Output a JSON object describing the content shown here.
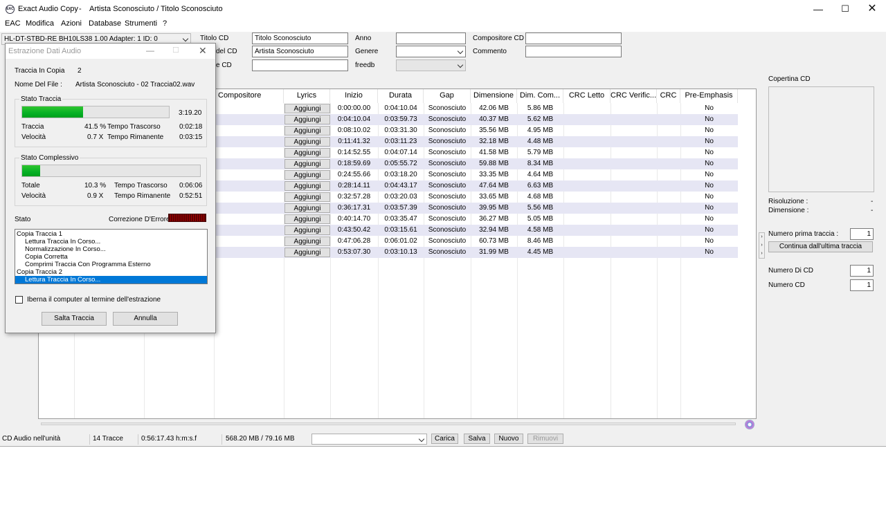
{
  "window": {
    "app_name": "Exact Audio Copy",
    "title": "Artista Sconosciuto / Titolo Sconosciuto",
    "icon_text": "EAC"
  },
  "menu": [
    "EAC",
    "Modifica",
    "Azioni",
    "Database",
    "Strumenti",
    "?"
  ],
  "drive": {
    "selected": "HL-DT-STBD-RE  BH10LS38 1.00   Adapter: 1  ID: 0"
  },
  "cdinfo": {
    "titolo_label": "Titolo CD",
    "titolo_value": "Titolo Sconosciuto",
    "artista_label": "del CD",
    "artista_value": "Artista Sconosciuto",
    "third_label": "e CD",
    "third_value": "",
    "anno_label": "Anno",
    "anno_value": "",
    "genere_label": "Genere",
    "genere_value": "",
    "freedb_label": "freedb",
    "freedb_value": "",
    "compositore_label": "Compositore CD",
    "compositore_value": "",
    "commento_label": "Commento",
    "commento_value": ""
  },
  "table": {
    "headers": [
      "Compositore",
      "Lyrics",
      "Inizio",
      "Durata",
      "Gap",
      "Dimensione",
      "Dim. Com...",
      "CRC Letto",
      "CRC Verific...",
      "CRC",
      "Pre-Emphasis"
    ],
    "lyrics_button": "Aggiungi",
    "rows": [
      {
        "inizio": "0:00:00.00",
        "durata": "0:04:10.04",
        "gap": "Sconosciuto",
        "dim": "42.06 MB",
        "dimc": "5.86 MB",
        "pre": "No"
      },
      {
        "inizio": "0:04:10.04",
        "durata": "0:03:59.73",
        "gap": "Sconosciuto",
        "dim": "40.37 MB",
        "dimc": "5.62 MB",
        "pre": "No"
      },
      {
        "inizio": "0:08:10.02",
        "durata": "0:03:31.30",
        "gap": "Sconosciuto",
        "dim": "35.56 MB",
        "dimc": "4.95 MB",
        "pre": "No"
      },
      {
        "inizio": "0:11:41.32",
        "durata": "0:03:11.23",
        "gap": "Sconosciuto",
        "dim": "32.18 MB",
        "dimc": "4.48 MB",
        "pre": "No"
      },
      {
        "inizio": "0:14:52.55",
        "durata": "0:04:07.14",
        "gap": "Sconosciuto",
        "dim": "41.58 MB",
        "dimc": "5.79 MB",
        "pre": "No"
      },
      {
        "inizio": "0:18:59.69",
        "durata": "0:05:55.72",
        "gap": "Sconosciuto",
        "dim": "59.88 MB",
        "dimc": "8.34 MB",
        "pre": "No"
      },
      {
        "inizio": "0:24:55.66",
        "durata": "0:03:18.20",
        "gap": "Sconosciuto",
        "dim": "33.35 MB",
        "dimc": "4.64 MB",
        "pre": "No"
      },
      {
        "inizio": "0:28:14.11",
        "durata": "0:04:43.17",
        "gap": "Sconosciuto",
        "dim": "47.64 MB",
        "dimc": "6.63 MB",
        "pre": "No"
      },
      {
        "inizio": "0:32:57.28",
        "durata": "0:03:20.03",
        "gap": "Sconosciuto",
        "dim": "33.65 MB",
        "dimc": "4.68 MB",
        "pre": "No"
      },
      {
        "inizio": "0:36:17.31",
        "durata": "0:03:57.39",
        "gap": "Sconosciuto",
        "dim": "39.95 MB",
        "dimc": "5.56 MB",
        "pre": "No"
      },
      {
        "inizio": "0:40:14.70",
        "durata": "0:03:35.47",
        "gap": "Sconosciuto",
        "dim": "36.27 MB",
        "dimc": "5.05 MB",
        "pre": "No"
      },
      {
        "inizio": "0:43:50.42",
        "durata": "0:03:15.61",
        "gap": "Sconosciuto",
        "dim": "32.94 MB",
        "dimc": "4.58 MB",
        "pre": "No"
      },
      {
        "inizio": "0:47:06.28",
        "durata": "0:06:01.02",
        "gap": "Sconosciuto",
        "dim": "60.73 MB",
        "dimc": "8.46 MB",
        "pre": "No"
      },
      {
        "inizio": "0:53:07.30",
        "durata": "0:03:10.13",
        "gap": "Sconosciuto",
        "dim": "31.99 MB",
        "dimc": "4.45 MB",
        "pre": "No"
      }
    ]
  },
  "right_panel": {
    "copertina": "Copertina CD",
    "risoluzione_label": "Risoluzione :",
    "risoluzione_value": "-",
    "dimensione_label": "Dimensione :",
    "dimensione_value": "-",
    "prima_traccia_label": "Numero prima traccia :",
    "prima_traccia_value": "1",
    "continua_button": "Continua dall'ultima traccia",
    "numero_di_cd_label": "Numero Di CD",
    "numero_di_cd_value": "1",
    "numero_cd_label": "Numero CD",
    "numero_cd_value": "1"
  },
  "status_bar": {
    "cd": "CD Audio nell'unità",
    "tracce": "14 Tracce",
    "durata": "0:56:17.43 h:m:s.f",
    "dimensioni": "568.20 MB /  79.16 MB",
    "carica": "Carica",
    "salva": "Salva",
    "nuovo": "Nuovo",
    "rimuovi": "Rimuovi"
  },
  "dialog": {
    "title": "Estrazione Dati Audio",
    "traccia_in_copia_label": "Traccia In Copia",
    "traccia_in_copia_value": "2",
    "nome_file_label": "Nome Del File :",
    "nome_file_value": "Artista Sconosciuto - 02 Traccia02.wav",
    "stato_traccia": {
      "title": "Stato Traccia",
      "time": "3:19.20",
      "progress": 0.415,
      "traccia_label": "Traccia",
      "traccia_value": "41.5 %",
      "velocita_label": "Velocità",
      "velocita_value": "0.7 X",
      "trascorso_label": "Tempo Trascorso",
      "trascorso_value": "0:02:18",
      "rimanente_label": "Tempo Rimanente",
      "rimanente_value": "0:03:15"
    },
    "stato_complessivo": {
      "title": "Stato Complessivo",
      "progress": 0.103,
      "totale_label": "Totale",
      "totale_value": "10.3 %",
      "velocita_label": "Velocità",
      "velocita_value": "0.9 X",
      "trascorso_label": "Tempo Trascorso",
      "trascorso_value": "0:06:06",
      "rimanente_label": "Tempo Rimanente",
      "rimanente_value": "0:52:51"
    },
    "stato_label": "Stato",
    "correzione_label": "Correzione D'Errore :",
    "log": [
      {
        "text": "Copia Traccia  1",
        "indent": false,
        "selected": false
      },
      {
        "text": "Lettura Traccia In Corso...",
        "indent": true,
        "selected": false
      },
      {
        "text": "Normalizzazione In Corso...",
        "indent": true,
        "selected": false
      },
      {
        "text": "Copia Corretta",
        "indent": true,
        "selected": false
      },
      {
        "text": "Comprimi Traccia Con Programma Esterno",
        "indent": true,
        "selected": false
      },
      {
        "text": "Copia Traccia  2",
        "indent": false,
        "selected": false
      },
      {
        "text": "Lettura Traccia In Corso...",
        "indent": true,
        "selected": true
      }
    ],
    "iberna_label": "Iberna il computer al termine dell'estrazione",
    "salta_button": "Salta Traccia",
    "annulla_button": "Annulla"
  }
}
